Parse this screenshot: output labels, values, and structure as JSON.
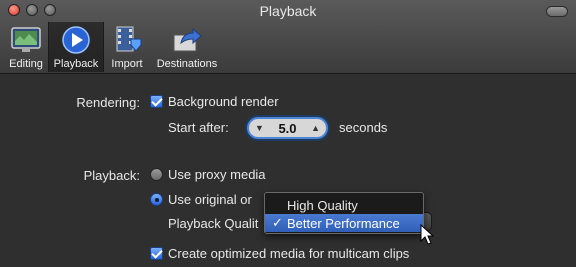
{
  "window": {
    "title": "Playback"
  },
  "toolbar": {
    "items": [
      {
        "label": "Editing",
        "icon": "film-monitor-icon"
      },
      {
        "label": "Playback",
        "icon": "play-icon",
        "selected": true
      },
      {
        "label": "Import",
        "icon": "filmstrip-arrow-icon"
      },
      {
        "label": "Destinations",
        "icon": "share-arrow-icon"
      }
    ]
  },
  "rendering": {
    "label": "Rendering:",
    "background_render_label": "Background render",
    "background_render_checked": true,
    "start_after_label": "Start after:",
    "start_after_value": "5.0",
    "seconds_label": "seconds"
  },
  "playback": {
    "label": "Playback:",
    "use_proxy_label": "Use proxy media",
    "use_original_label": "Use original or",
    "playback_quality_label": "Playback Qualit",
    "menu": {
      "items": [
        "High Quality",
        "Better Performance"
      ],
      "selected": "Better Performance"
    },
    "create_optimized_label": "Create optimized media for multicam clips",
    "create_optimized_checked": true
  },
  "colors": {
    "accent": "#3c6fd0",
    "background": "#2f2f2f",
    "close_button": "#d8342a"
  }
}
